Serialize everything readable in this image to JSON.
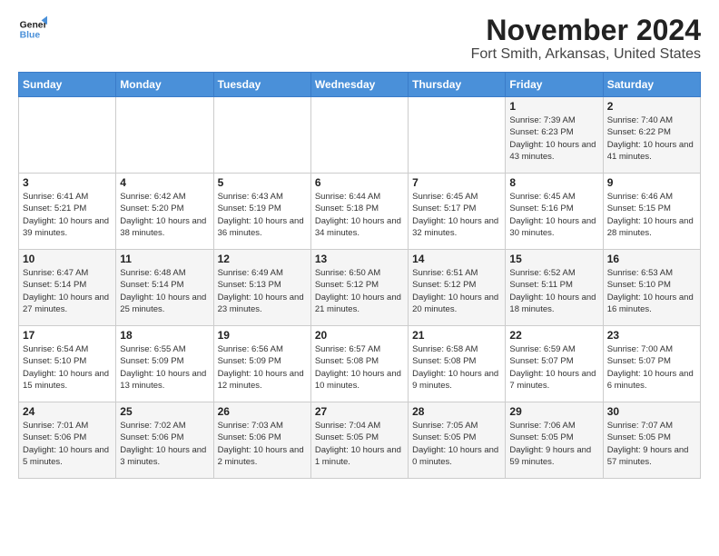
{
  "logo": {
    "line1": "General",
    "line2": "Blue"
  },
  "title": "November 2024",
  "subtitle": "Fort Smith, Arkansas, United States",
  "header": {
    "accent_color": "#4a90d9"
  },
  "weekdays": [
    "Sunday",
    "Monday",
    "Tuesday",
    "Wednesday",
    "Thursday",
    "Friday",
    "Saturday"
  ],
  "weeks": [
    [
      {
        "day": "",
        "info": ""
      },
      {
        "day": "",
        "info": ""
      },
      {
        "day": "",
        "info": ""
      },
      {
        "day": "",
        "info": ""
      },
      {
        "day": "",
        "info": ""
      },
      {
        "day": "1",
        "info": "Sunrise: 7:39 AM\nSunset: 6:23 PM\nDaylight: 10 hours and 43 minutes."
      },
      {
        "day": "2",
        "info": "Sunrise: 7:40 AM\nSunset: 6:22 PM\nDaylight: 10 hours and 41 minutes."
      }
    ],
    [
      {
        "day": "3",
        "info": "Sunrise: 6:41 AM\nSunset: 5:21 PM\nDaylight: 10 hours and 39 minutes."
      },
      {
        "day": "4",
        "info": "Sunrise: 6:42 AM\nSunset: 5:20 PM\nDaylight: 10 hours and 38 minutes."
      },
      {
        "day": "5",
        "info": "Sunrise: 6:43 AM\nSunset: 5:19 PM\nDaylight: 10 hours and 36 minutes."
      },
      {
        "day": "6",
        "info": "Sunrise: 6:44 AM\nSunset: 5:18 PM\nDaylight: 10 hours and 34 minutes."
      },
      {
        "day": "7",
        "info": "Sunrise: 6:45 AM\nSunset: 5:17 PM\nDaylight: 10 hours and 32 minutes."
      },
      {
        "day": "8",
        "info": "Sunrise: 6:45 AM\nSunset: 5:16 PM\nDaylight: 10 hours and 30 minutes."
      },
      {
        "day": "9",
        "info": "Sunrise: 6:46 AM\nSunset: 5:15 PM\nDaylight: 10 hours and 28 minutes."
      }
    ],
    [
      {
        "day": "10",
        "info": "Sunrise: 6:47 AM\nSunset: 5:14 PM\nDaylight: 10 hours and 27 minutes."
      },
      {
        "day": "11",
        "info": "Sunrise: 6:48 AM\nSunset: 5:14 PM\nDaylight: 10 hours and 25 minutes."
      },
      {
        "day": "12",
        "info": "Sunrise: 6:49 AM\nSunset: 5:13 PM\nDaylight: 10 hours and 23 minutes."
      },
      {
        "day": "13",
        "info": "Sunrise: 6:50 AM\nSunset: 5:12 PM\nDaylight: 10 hours and 21 minutes."
      },
      {
        "day": "14",
        "info": "Sunrise: 6:51 AM\nSunset: 5:12 PM\nDaylight: 10 hours and 20 minutes."
      },
      {
        "day": "15",
        "info": "Sunrise: 6:52 AM\nSunset: 5:11 PM\nDaylight: 10 hours and 18 minutes."
      },
      {
        "day": "16",
        "info": "Sunrise: 6:53 AM\nSunset: 5:10 PM\nDaylight: 10 hours and 16 minutes."
      }
    ],
    [
      {
        "day": "17",
        "info": "Sunrise: 6:54 AM\nSunset: 5:10 PM\nDaylight: 10 hours and 15 minutes."
      },
      {
        "day": "18",
        "info": "Sunrise: 6:55 AM\nSunset: 5:09 PM\nDaylight: 10 hours and 13 minutes."
      },
      {
        "day": "19",
        "info": "Sunrise: 6:56 AM\nSunset: 5:09 PM\nDaylight: 10 hours and 12 minutes."
      },
      {
        "day": "20",
        "info": "Sunrise: 6:57 AM\nSunset: 5:08 PM\nDaylight: 10 hours and 10 minutes."
      },
      {
        "day": "21",
        "info": "Sunrise: 6:58 AM\nSunset: 5:08 PM\nDaylight: 10 hours and 9 minutes."
      },
      {
        "day": "22",
        "info": "Sunrise: 6:59 AM\nSunset: 5:07 PM\nDaylight: 10 hours and 7 minutes."
      },
      {
        "day": "23",
        "info": "Sunrise: 7:00 AM\nSunset: 5:07 PM\nDaylight: 10 hours and 6 minutes."
      }
    ],
    [
      {
        "day": "24",
        "info": "Sunrise: 7:01 AM\nSunset: 5:06 PM\nDaylight: 10 hours and 5 minutes."
      },
      {
        "day": "25",
        "info": "Sunrise: 7:02 AM\nSunset: 5:06 PM\nDaylight: 10 hours and 3 minutes."
      },
      {
        "day": "26",
        "info": "Sunrise: 7:03 AM\nSunset: 5:06 PM\nDaylight: 10 hours and 2 minutes."
      },
      {
        "day": "27",
        "info": "Sunrise: 7:04 AM\nSunset: 5:05 PM\nDaylight: 10 hours and 1 minute."
      },
      {
        "day": "28",
        "info": "Sunrise: 7:05 AM\nSunset: 5:05 PM\nDaylight: 10 hours and 0 minutes."
      },
      {
        "day": "29",
        "info": "Sunrise: 7:06 AM\nSunset: 5:05 PM\nDaylight: 9 hours and 59 minutes."
      },
      {
        "day": "30",
        "info": "Sunrise: 7:07 AM\nSunset: 5:05 PM\nDaylight: 9 hours and 57 minutes."
      }
    ]
  ]
}
